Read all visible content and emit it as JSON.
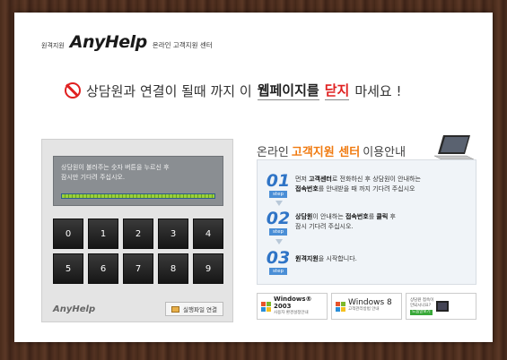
{
  "header": {
    "small_label": "원격지원",
    "brand": "AnyHelp",
    "subtitle": "온라인 고객지원 센터"
  },
  "warning": {
    "text_prefix": "상담원과 연결이 될때 까지 이",
    "text_bold": "웹페이지를",
    "text_red": "닫지",
    "text_suffix": "마세요 !"
  },
  "left_panel": {
    "screen_text_line1": "상담원이 불러주는 숫자 버튼을 누르신 후",
    "screen_text_line2": "잠시만 기다려 주십시오.",
    "progress_fraction": 1.0,
    "keys": [
      "0",
      "1",
      "2",
      "3",
      "4",
      "5",
      "6",
      "7",
      "8",
      "9"
    ],
    "logo": "AnyHelp",
    "run_button": "실행파일 연결"
  },
  "right_panel": {
    "title_prefix": "온라인",
    "title_highlight": "고객지원 센터",
    "title_suffix": "이용안내",
    "steps": [
      {
        "num": "01",
        "tag": "step",
        "line1_pre": "먼저 ",
        "line1_bold": "고객센터",
        "line1_post": "로 전화하신 후 상담원이 안내하는",
        "line2_bold": "접속번호",
        "line2_post": "를 안내받을 때 까지 기다려 주십시오"
      },
      {
        "num": "02",
        "tag": "step",
        "line1_bold": "상담원",
        "line1_post": "이 안내하는 ",
        "line1_bold2": "접속번호",
        "line1_post2": "를 ",
        "line1_bold3": "클릭",
        "line1_post3": " 후",
        "line2_post": "잠시 기다려 주십시오."
      },
      {
        "num": "03",
        "tag": "step",
        "line1_bold": "원격지원",
        "line1_post": "을 시작합니다."
      }
    ]
  },
  "bottom": {
    "os1_name": "Windows® 2003",
    "os1_sub": "사용자 환경설정안내",
    "os2_name": "Windows 8",
    "os2_sub": "고객관리방법 안내",
    "q_line1": "상담원 접속이",
    "q_line2": "안되시나요?",
    "q_button": "도움말보기"
  },
  "colors": {
    "accent_orange": "#f07a10",
    "warning_red": "#e02020",
    "step_blue": "#2f74c6"
  }
}
